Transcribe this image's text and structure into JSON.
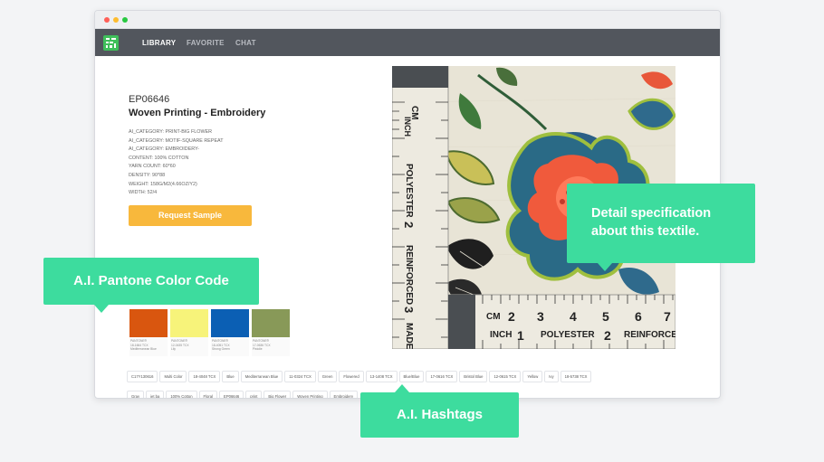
{
  "nav": {
    "items": [
      "LIBRARY",
      "FAVORITE",
      "CHAT"
    ],
    "active": "LIBRARY"
  },
  "product": {
    "code": "EP06646",
    "title": "Woven Printing - Embroidery",
    "specs": [
      "AI_CATEGORY: PRINT-BIG FLOWER",
      "AI_CATEGORY: MOTIF-SQUARE REPEAT",
      "AI_CATEGORY: EMBROIDERY-",
      "CONTENT: 100% COTTON",
      "YARN COUNT: 60*60",
      "DENSITY: 90*88",
      "WEIGHT: 158G/M2(4.66OZ/Y2)",
      "WIDTH: 52/4"
    ],
    "request_button": "Request Sample"
  },
  "swatches": [
    {
      "color": "#d9560f",
      "brand": "PANTONE®",
      "code": "18-1664 TCX",
      "name": "Mediterranean Blue"
    },
    {
      "color": "#f7f37a",
      "brand": "PANTONE®",
      "code": "12-0435 TCX",
      "name": "Lily"
    },
    {
      "color": "#0b5fb4",
      "brand": "PANTONE®",
      "code": "18-4051 TCX",
      "name": "Strong Green"
    },
    {
      "color": "#889958",
      "brand": "PANTONE®",
      "code": "17-0636 TCX",
      "name": "Pistolie"
    }
  ],
  "hashtags": [
    "C17Y130616",
    "Multi Color",
    "18-4048 TCX",
    "Blue",
    "Mediterranean Blue",
    "11-0324 TCX",
    "Green",
    "Flowered",
    "13-1408 TCX",
    "Blue/Blue",
    "17-0616 TCX",
    "Bristol Blue",
    "12-0615 TCX",
    "Yellow",
    "Ivy",
    "18-5738 TCX",
    "Gray",
    "jet ba",
    "100% Cotton",
    "Floral",
    "EP06646",
    "print",
    "Big Flower",
    "Woven Printing",
    "Embroidery"
  ],
  "callouts": {
    "pantone": "A.I. Pantone Color Code",
    "detail": "Detail specification about this textile.",
    "hashtags": "A.I. Hashtags"
  },
  "ruler": {
    "vertical": [
      "CM",
      "INCH",
      "POLYESTER",
      "2",
      "REINFORCED",
      "3",
      "MADE"
    ],
    "horizontal": [
      "CM",
      "2",
      "3",
      "INCH",
      "1",
      "POLYESTER",
      "4",
      "5",
      "2",
      "6",
      "7",
      "REINFORCE"
    ]
  },
  "colors": {
    "accent": "#3ddc9e",
    "button": "#f8b83c",
    "navbar": "#52565d"
  }
}
